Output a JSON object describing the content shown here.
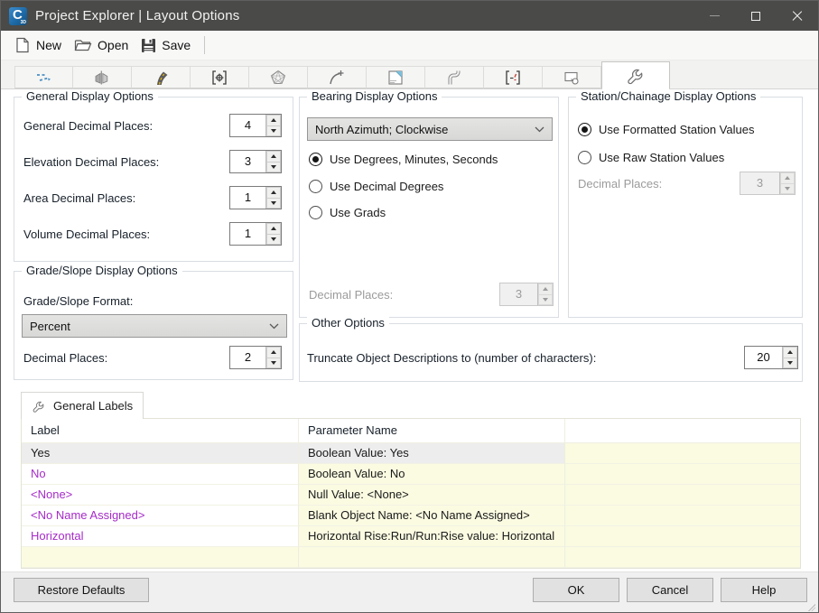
{
  "window": {
    "title": "Project Explorer | Layout Options",
    "app_icon": {
      "letter": "C",
      "sub": "3D"
    },
    "controls": [
      "minimize-icon",
      "maximize-icon",
      "close-icon"
    ]
  },
  "toolbar": {
    "new_label": "New",
    "open_label": "Open",
    "save_label": "Save",
    "icons": [
      "new-document-icon",
      "open-folder-icon",
      "save-floppy-icon"
    ]
  },
  "tabs": [
    {
      "icon": "alignments-icon"
    },
    {
      "icon": "cross-sections-icon"
    },
    {
      "icon": "corridors-icon"
    },
    {
      "icon": "point-groups-icon"
    },
    {
      "icon": "surfaces-icon"
    },
    {
      "icon": "feature-lines-icon"
    },
    {
      "icon": "sheets-icon"
    },
    {
      "icon": "pipe-networks-icon"
    },
    {
      "icon": "labels-icon"
    },
    {
      "icon": "viewports-icon"
    },
    {
      "icon": "layout-options-wrench-icon",
      "active": true
    }
  ],
  "general_display": {
    "title": "General Display Options",
    "fields": [
      {
        "label": "General Decimal Places:",
        "value": "4"
      },
      {
        "label": "Elevation Decimal Places:",
        "value": "3"
      },
      {
        "label": "Area Decimal Places:",
        "value": "1"
      },
      {
        "label": "Volume Decimal Places:",
        "value": "1"
      }
    ]
  },
  "grade_slope": {
    "title": "Grade/Slope Display Options",
    "format_label": "Grade/Slope Format:",
    "format_value": "Percent",
    "decimal_label": "Decimal Places:",
    "decimal_value": "2"
  },
  "bearing": {
    "title": "Bearing Display Options",
    "dropdown_value": "North Azimuth; Clockwise",
    "radios": [
      {
        "label": "Use Degrees, Minutes, Seconds",
        "checked": true
      },
      {
        "label": "Use Decimal Degrees",
        "checked": false
      },
      {
        "label": "Use Grads",
        "checked": false
      }
    ],
    "decimal_label": "Decimal Places:",
    "decimal_value": "3",
    "decimal_disabled": true
  },
  "station": {
    "title": "Station/Chainage Display Options",
    "radios": [
      {
        "label": "Use Formatted Station Values",
        "checked": true
      },
      {
        "label": "Use Raw Station Values",
        "checked": false
      }
    ],
    "decimal_label": "Decimal Places:",
    "decimal_value": "3",
    "decimal_disabled": true
  },
  "other": {
    "title": "Other Options",
    "truncate_label": "Truncate Object Descriptions to (number of characters):",
    "truncate_value": "20"
  },
  "labels_section": {
    "tab_label": "General Labels",
    "tab_icon": "wrench-icon",
    "columns": [
      "Label",
      "Parameter Name"
    ],
    "rows": [
      {
        "label": "Yes",
        "parameter": "Boolean Value: Yes",
        "selected": true
      },
      {
        "label": "No",
        "parameter": "Boolean Value: No"
      },
      {
        "label": "<None>",
        "parameter": "Null Value: <None>"
      },
      {
        "label": "<No Name Assigned>",
        "parameter": "Blank Object Name: <No Name Assigned>"
      },
      {
        "label": "Horizontal",
        "parameter": "Horizontal Rise:Run/Run:Rise value: Horizontal"
      },
      {
        "label": "",
        "parameter": ""
      }
    ]
  },
  "footer": {
    "restore_defaults": "Restore Defaults",
    "ok": "OK",
    "cancel": "Cancel",
    "help": "Help"
  },
  "colors": {
    "titlebar": "#4a4a48",
    "brand_blue": "#1d6aa8",
    "table_yellow": "#fbfbe2",
    "selected_row": "#ededed",
    "magenta_text": "#a62bc8"
  }
}
